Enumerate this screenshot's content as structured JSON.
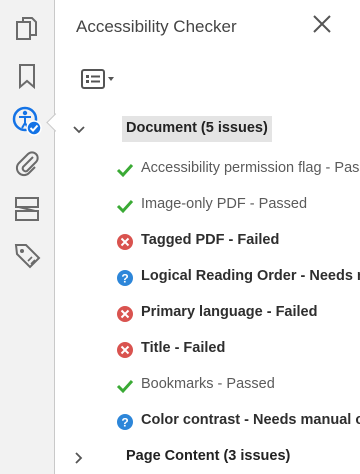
{
  "panel": {
    "title": "Accessibility Checker"
  },
  "tool_rail": {
    "items": [
      {
        "icon": "pages-icon"
      },
      {
        "icon": "bookmark-icon"
      },
      {
        "icon": "accessibility-check-icon"
      },
      {
        "icon": "attachment-icon"
      },
      {
        "icon": "content-order-icon"
      },
      {
        "icon": "tags-icon"
      }
    ]
  },
  "sections": [
    {
      "label": "Document (5 issues)",
      "expanded": true
    },
    {
      "label": "Page Content (3 issues)",
      "expanded": false
    }
  ],
  "checks": [
    {
      "label": "Accessibility permission flag - Passed",
      "status": "passed"
    },
    {
      "label": "Image-only PDF - Passed",
      "status": "passed"
    },
    {
      "label": "Tagged PDF - Failed",
      "status": "failed"
    },
    {
      "label": "Logical Reading Order - Needs manual check",
      "status": "manual"
    },
    {
      "label": "Primary language - Failed",
      "status": "failed"
    },
    {
      "label": "Title - Failed",
      "status": "failed"
    },
    {
      "label": "Bookmarks - Passed",
      "status": "passed"
    },
    {
      "label": "Color contrast - Needs manual check",
      "status": "manual"
    }
  ],
  "colors": {
    "passed": "#3aaa35",
    "failed": "#d9534f",
    "manual": "#2d86d9",
    "accent": "#1473e6"
  }
}
